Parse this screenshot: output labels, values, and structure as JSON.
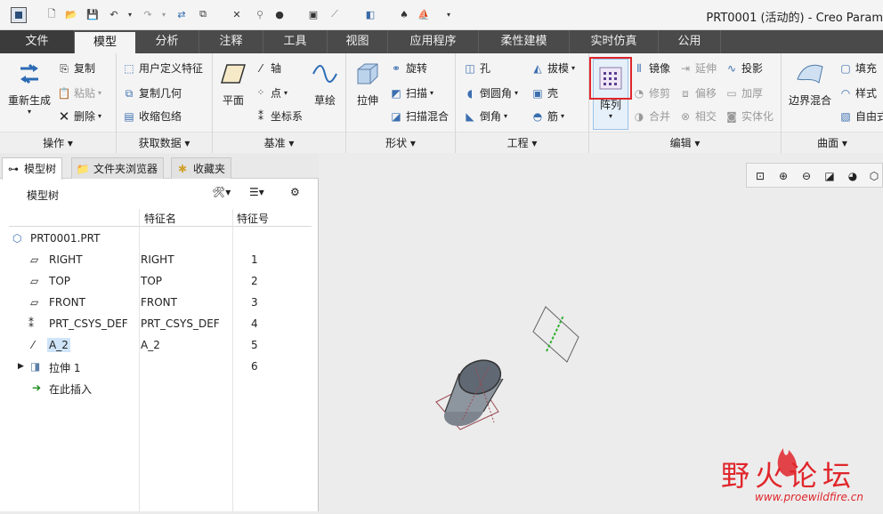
{
  "window": {
    "title": "PRT0001 (活动的) - Creo Param"
  },
  "quick_access": [
    "app-icon",
    "new-icon",
    "open-icon",
    "save-icon",
    "undo-icon",
    "redo-icon",
    "regenerate-icon",
    "window-icon",
    "close-icon"
  ],
  "tabs": [
    {
      "label": "文件"
    },
    {
      "label": "模型"
    },
    {
      "label": "分析"
    },
    {
      "label": "注释"
    },
    {
      "label": "工具"
    },
    {
      "label": "视图"
    },
    {
      "label": "应用程序"
    },
    {
      "label": "柔性建模"
    },
    {
      "label": "实时仿真"
    },
    {
      "label": "公用"
    }
  ],
  "ribbon": {
    "operations": {
      "label": "操作",
      "regenerate": "重新生成",
      "copy": "复制",
      "paste": "粘贴",
      "delete": "删除"
    },
    "get_data": {
      "label": "获取数据",
      "udf": "用户定义特征",
      "copy_geom": "复制几何",
      "shrinkwrap": "收缩包络"
    },
    "datum": {
      "label": "基准",
      "plane": "平面",
      "axis": "轴",
      "point": "点",
      "csys": "坐标系",
      "sketch": "草绘"
    },
    "shapes": {
      "label": "形状",
      "extrude": "拉伸",
      "revolve": "旋转",
      "sweep": "扫描",
      "swept_blend": "扫描混合"
    },
    "engineering": {
      "label": "工程",
      "hole": "孔",
      "round": "倒圆角",
      "chamfer": "倒角",
      "draft": "拔模",
      "shell": "壳",
      "rib": "筋"
    },
    "editing": {
      "label": "编辑",
      "pattern": "阵列",
      "mirror": "镜像",
      "trim": "修剪",
      "merge": "合并",
      "extend": "延伸",
      "offset": "偏移",
      "intersect": "相交",
      "project": "投影",
      "thicken": "加厚",
      "solidify": "实体化"
    },
    "surfaces": {
      "label": "曲面",
      "boundary_blend": "边界混合",
      "fill": "填充",
      "style": "样式",
      "freestyle": "自由式"
    }
  },
  "panel": {
    "tabs": [
      "模型树",
      "文件夹浏览器",
      "收藏夹"
    ],
    "title": "模型树",
    "columns": [
      "特征名",
      "特征号"
    ],
    "rows": [
      {
        "name": "PRT0001.PRT",
        "feat": "",
        "num": ""
      },
      {
        "name": "RIGHT",
        "feat": "RIGHT",
        "num": "1"
      },
      {
        "name": "TOP",
        "feat": "TOP",
        "num": "2"
      },
      {
        "name": "FRONT",
        "feat": "FRONT",
        "num": "3"
      },
      {
        "name": "PRT_CSYS_DEF",
        "feat": "PRT_CSYS_DEF",
        "num": "4"
      },
      {
        "name": "A_2",
        "feat": "A_2",
        "num": "5"
      },
      {
        "name": "拉伸 1",
        "feat": "",
        "num": "6"
      },
      {
        "name": "在此插入",
        "feat": "",
        "num": ""
      }
    ]
  },
  "watermark": {
    "text": "野火论坛",
    "url": "www.proewildfire.cn"
  },
  "colors": {
    "accent": "#e0262b",
    "tab_bar": "#4a4a4a"
  }
}
